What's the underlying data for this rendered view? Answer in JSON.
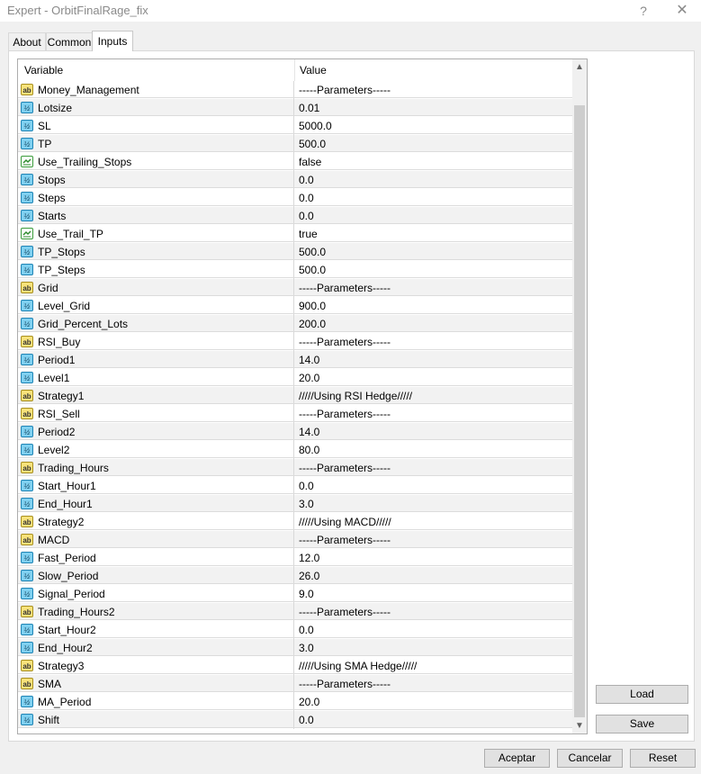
{
  "window": {
    "title": "Expert - OrbitFinalRage_fix",
    "help_label": "?",
    "close_label": "✕"
  },
  "tabs": [
    {
      "label": "About"
    },
    {
      "label": "Common"
    },
    {
      "label": "Inputs"
    }
  ],
  "table": {
    "headers": {
      "variable": "Variable",
      "value": "Value"
    },
    "rows": [
      {
        "name": "Money_Management",
        "value": "-----Parameters-----",
        "type": "string"
      },
      {
        "name": "Lotsize",
        "value": "0.01",
        "type": "number"
      },
      {
        "name": "SL",
        "value": "5000.0",
        "type": "number"
      },
      {
        "name": "TP",
        "value": "500.0",
        "type": "number"
      },
      {
        "name": "Use_Trailing_Stops",
        "value": "false",
        "type": "bool"
      },
      {
        "name": "Stops",
        "value": "0.0",
        "type": "number"
      },
      {
        "name": "Steps",
        "value": "0.0",
        "type": "number"
      },
      {
        "name": "Starts",
        "value": "0.0",
        "type": "number"
      },
      {
        "name": "Use_Trail_TP",
        "value": "true",
        "type": "bool"
      },
      {
        "name": "TP_Stops",
        "value": "500.0",
        "type": "number"
      },
      {
        "name": "TP_Steps",
        "value": "500.0",
        "type": "number"
      },
      {
        "name": "Grid",
        "value": "-----Parameters-----",
        "type": "string"
      },
      {
        "name": "Level_Grid",
        "value": "900.0",
        "type": "number"
      },
      {
        "name": "Grid_Percent_Lots",
        "value": "200.0",
        "type": "number"
      },
      {
        "name": "RSI_Buy",
        "value": "-----Parameters-----",
        "type": "string"
      },
      {
        "name": "Period1",
        "value": "14.0",
        "type": "number"
      },
      {
        "name": "Level1",
        "value": "20.0",
        "type": "number"
      },
      {
        "name": "Strategy1",
        "value": "/////Using RSI Hedge/////",
        "type": "string"
      },
      {
        "name": "RSI_Sell",
        "value": "-----Parameters-----",
        "type": "string"
      },
      {
        "name": "Period2",
        "value": "14.0",
        "type": "number"
      },
      {
        "name": "Level2",
        "value": "80.0",
        "type": "number"
      },
      {
        "name": "Trading_Hours",
        "value": "-----Parameters-----",
        "type": "string"
      },
      {
        "name": "Start_Hour1",
        "value": "0.0",
        "type": "number"
      },
      {
        "name": "End_Hour1",
        "value": "3.0",
        "type": "number"
      },
      {
        "name": "Strategy2",
        "value": "/////Using MACD/////",
        "type": "string"
      },
      {
        "name": "MACD",
        "value": "-----Parameters-----",
        "type": "string"
      },
      {
        "name": "Fast_Period",
        "value": "12.0",
        "type": "number"
      },
      {
        "name": "Slow_Period",
        "value": "26.0",
        "type": "number"
      },
      {
        "name": "Signal_Period",
        "value": "9.0",
        "type": "number"
      },
      {
        "name": "Trading_Hours2",
        "value": "-----Parameters-----",
        "type": "string"
      },
      {
        "name": "Start_Hour2",
        "value": "0.0",
        "type": "number"
      },
      {
        "name": "End_Hour2",
        "value": "3.0",
        "type": "number"
      },
      {
        "name": "Strategy3",
        "value": "/////Using SMA Hedge/////",
        "type": "string"
      },
      {
        "name": "SMA",
        "value": "-----Parameters-----",
        "type": "string"
      },
      {
        "name": "MA_Period",
        "value": "20.0",
        "type": "number"
      },
      {
        "name": "Shift",
        "value": "0.0",
        "type": "number"
      }
    ]
  },
  "icons": {
    "string": "ab",
    "number": "½"
  },
  "buttons": {
    "load": "Load",
    "save": "Save",
    "ok": "Aceptar",
    "cancel": "Cancelar",
    "reset": "Reset"
  },
  "scrollbar": {
    "up": "▲",
    "down": "▼"
  }
}
